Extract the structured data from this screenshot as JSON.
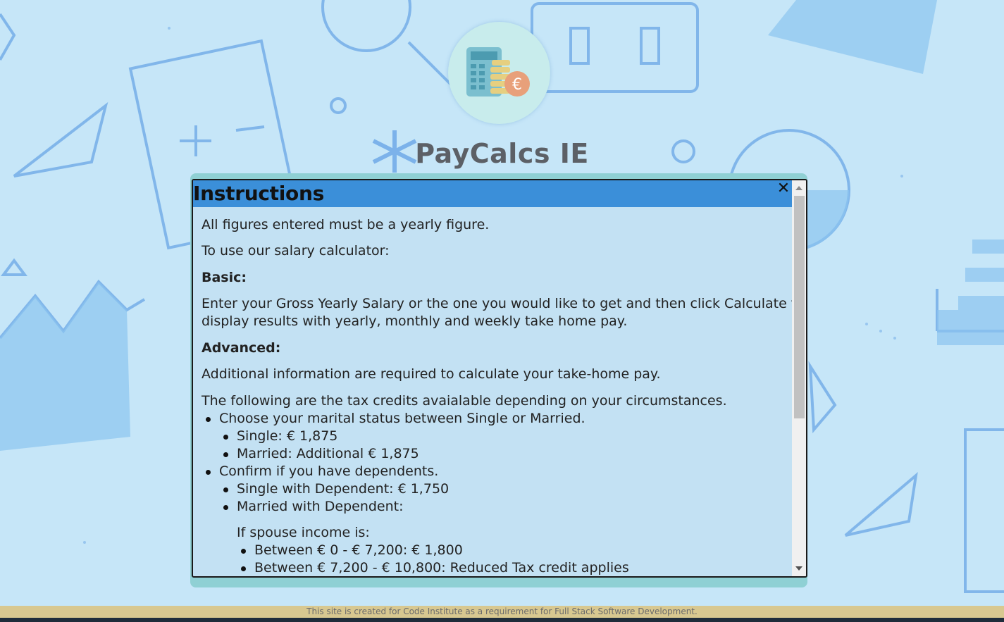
{
  "site": {
    "title": "PayCalcs IE",
    "logo_icon": "calculator-coins-euro-icon"
  },
  "modal": {
    "title": "Instructions",
    "close_label": "✕",
    "intro_1": "All figures entered must be a yearly figure.",
    "intro_2": "To use our salary calculator:",
    "basic_heading": "Basic:",
    "basic_text_line1": "Enter your Gross Yearly Salary or the one you would like to get and then click Calculate to",
    "basic_text_line2": "display results with yearly, monthly and weekly take home pay.",
    "advanced_heading": "Advanced:",
    "advanced_text": "Additional information are required to calculate your take-home pay.",
    "credits_intro": "The following are the tax credits avaialable depending on your circumstances.",
    "items": [
      "Choose your marital status between Single or Married.",
      "Single: € 1,875",
      "Married: Additional € 1,875",
      "Confirm if you have dependents.",
      "Single with Dependent: € 1,750",
      "Married with Dependent:",
      "If spouse income is:",
      "Between € 0 - € 7,200: € 1,800",
      "Between € 7,200 - € 10,800: Reduced Tax credit applies"
    ]
  },
  "footer": {
    "text": "This site is created for Code Institute as a requirement for Full Stack Software Development."
  },
  "colors": {
    "background": "#c6e6f8",
    "modal_header": "#3b8fd9",
    "modal_body": "#c3e1f3",
    "panel_border": "#8fd0d4",
    "footer": "#d8c890"
  }
}
